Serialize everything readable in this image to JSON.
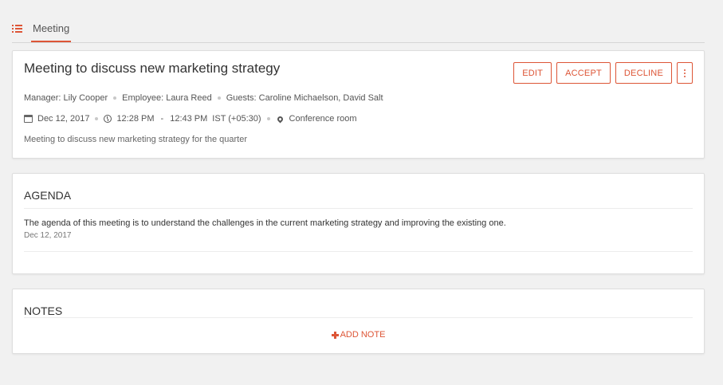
{
  "tab": {
    "label": "Meeting",
    "icon": "list-icon"
  },
  "meeting": {
    "title": "Meeting to discuss new marketing strategy",
    "actions": {
      "edit": "EDIT",
      "accept": "ACCEPT",
      "decline": "DECLINE",
      "more_icon": "more-vertical-icon"
    },
    "manager": "Manager: Lily Cooper",
    "employee": "Employee: Laura Reed",
    "guests": "Guests: Caroline Michaelson, David Salt",
    "date": "Dec 12, 2017",
    "start_time": "12:28 PM",
    "time_separator": "-",
    "end_time": "12:43 PM",
    "timezone": "IST (+05:30)",
    "location": "Conference room",
    "description": "Meeting to discuss new marketing strategy for the quarter"
  },
  "agenda": {
    "title": "AGENDA",
    "text": "The agenda of this meeting is to understand the challenges in the current marketing strategy and improving the existing one.",
    "date": "Dec 12, 2017"
  },
  "notes": {
    "title": "NOTES",
    "add_label": "ADD NOTE"
  },
  "colors": {
    "accent": "#dd5536",
    "background": "#f1f1f1",
    "card": "#ffffff"
  }
}
